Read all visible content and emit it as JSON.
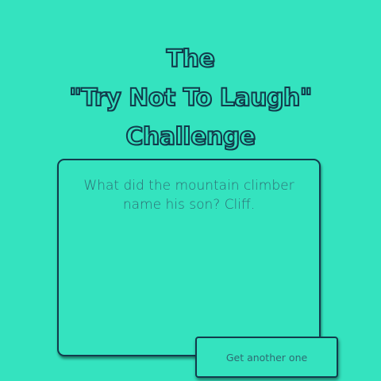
{
  "header": {
    "title_lines": [
      "The",
      "\"Try Not To Laugh\"",
      "Challenge"
    ]
  },
  "joke": {
    "text": "What did the mountain climber name his son? Cliff."
  },
  "actions": {
    "next_label": "Get another one"
  },
  "colors": {
    "background": "#34e3bf",
    "ink": "#123b4c",
    "text": "#2e6b72"
  }
}
